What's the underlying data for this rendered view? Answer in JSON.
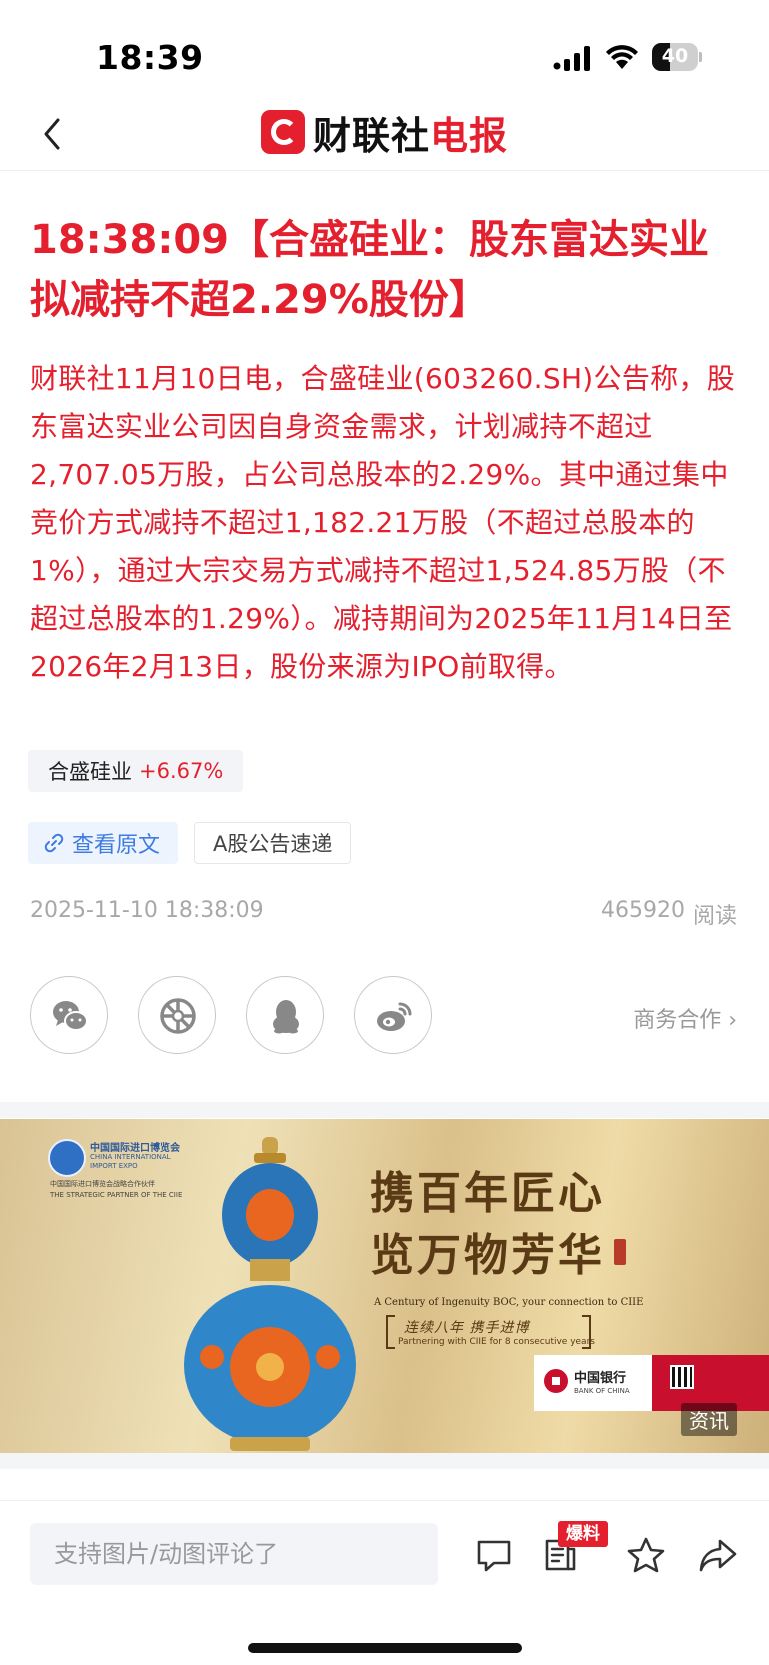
{
  "status_bar": {
    "time": "18:39",
    "battery": "40",
    "battery_level": 0.4
  },
  "nav": {
    "logo_black": "财联社",
    "logo_red": "电报"
  },
  "article": {
    "headline": "18:38:09【合盛硅业：股东富达实业拟减持不超2.29%股份】",
    "body": "财联社11月10日电，合盛硅业(603260.SH)公告称，股东富达实业公司因自身资金需求，计划减持不超过2,707.05万股，占公司总股本的2.29%。其中通过集中竞价方式减持不超过1,182.21万股（不超过总股本的1%），通过大宗交易方式减持不超过1,524.85万股（不超过总股本的1.29%）。减持期间为2025年11月14日至2026年2月13日，股份来源为IPO前取得。",
    "stock": {
      "name": "合盛硅业",
      "change": "+6.67%"
    },
    "view_original": "查看原文",
    "topic_tag": "A股公告速递",
    "date": "2025-11-10 18:38:09",
    "reads": "465920",
    "reads_label": "阅读"
  },
  "share": {
    "items": [
      "wechat-icon",
      "moments-icon",
      "qq-icon",
      "weibo-icon"
    ],
    "business": "商务合作 ›"
  },
  "ad": {
    "expo_cn": "中国国际进口博览会",
    "expo_en": "CHINA INTERNATIONAL IMPORT EXPO",
    "expo_sub_cn": "中国国际进口博览会战略合作伙伴",
    "expo_sub_en": "THE STRATEGIC PARTNER OF THE CIIE",
    "calligraphy_line1": "携百年匠心",
    "calligraphy_line2": "览万物芳华",
    "en_tagline": "A Century of Ingenuity BOC, your connection to CIIE",
    "cn_line": "连续八年 携手进博",
    "en_line": "Partnering with CIIE for 8 consecutive years",
    "bank_cn": "中国银行",
    "bank_en": "BANK OF CHINA",
    "label": "资讯"
  },
  "bottom_bar": {
    "comment_placeholder": "支持图片/动图评论了",
    "badge": "爆料",
    "actions": [
      "comment-icon",
      "report-icon",
      "star-icon",
      "share-icon"
    ]
  }
}
